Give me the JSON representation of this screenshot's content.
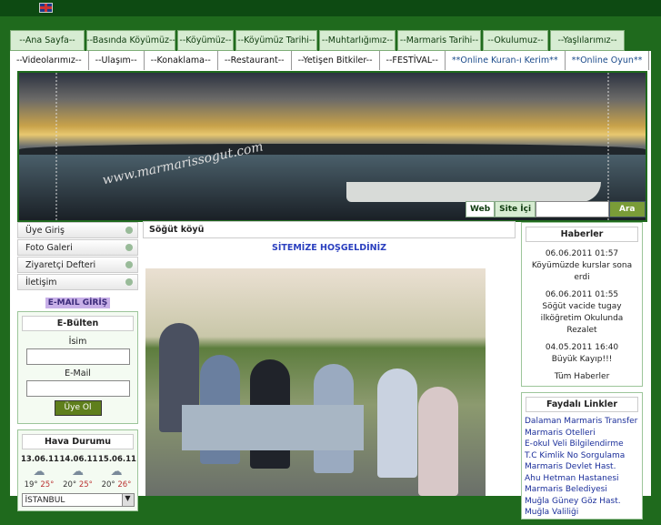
{
  "top": {
    "flag_icon": "uk-flag-icon"
  },
  "nav_primary": [
    "--Ana Sayfa--",
    "--Basında Köyümüz--",
    "--Köyümüz--",
    "--Köyümüz Tarihi--",
    "--Muhtarlığımız--",
    "--Marmaris Tarihi--",
    "--Okulumuz--",
    "--Yaşlılarımız--"
  ],
  "nav_secondary": [
    "--Videolarımız--",
    "--Ulaşım--",
    "--Konaklama--",
    "--Restaurant--",
    "--Yetişen Bitkiler--",
    "--FESTİVAL--",
    "**Online Kuran-ı Kerim**",
    "**Online Oyun**"
  ],
  "banner": {
    "watermark": "www.marmarissogut.com"
  },
  "search": {
    "web": "Web",
    "site": "Site İçi",
    "button": "Ara"
  },
  "left": {
    "links": [
      "Üye Giriş",
      "Foto Galeri",
      "Ziyaretçi Defteri",
      "İletişim"
    ],
    "email_login": "E-MAIL GİRİŞ",
    "bulletin": {
      "title": "E-Bülten",
      "name_label": "İsim",
      "email_label": "E-Mail",
      "button": "Üye Ol"
    },
    "weather": {
      "title": "Hava Durumu",
      "days": [
        {
          "date": "13.06.11",
          "low": "19°",
          "high": "25°"
        },
        {
          "date": "14.06.11",
          "low": "20°",
          "high": "25°"
        },
        {
          "date": "15.06.11",
          "low": "20°",
          "high": "26°"
        }
      ],
      "city": "İSTANBUL"
    }
  },
  "center": {
    "breadcrumb": "Söğüt köyü",
    "welcome": "SİTEMİZE HOŞGELDİNİZ"
  },
  "right": {
    "news_title": "Haberler",
    "news": [
      {
        "time": "06.06.2011 01:57",
        "text": "Köyümüzde kurslar sona erdi"
      },
      {
        "time": "06.06.2011 01:55",
        "text": "Söğüt vacide tugay ilköğretim Okulunda Rezalet"
      },
      {
        "time": "04.05.2011 16:40",
        "text": "Büyük Kayıp!!!"
      }
    ],
    "all_news": "Tüm Haberler",
    "links_title": "Faydalı Linkler",
    "links": [
      "Dalaman Marmaris Transfer",
      "Marmaris Otelleri",
      "E-okul Veli Bilgilendirme",
      "T.C Kimlik No Sorgulama",
      "Marmaris Devlet Hast.",
      "Ahu Hetman Hastanesi",
      "Marmaris Belediyesi",
      "Muğla Güney Göz Hast.",
      "Muğla Valiliği"
    ]
  }
}
